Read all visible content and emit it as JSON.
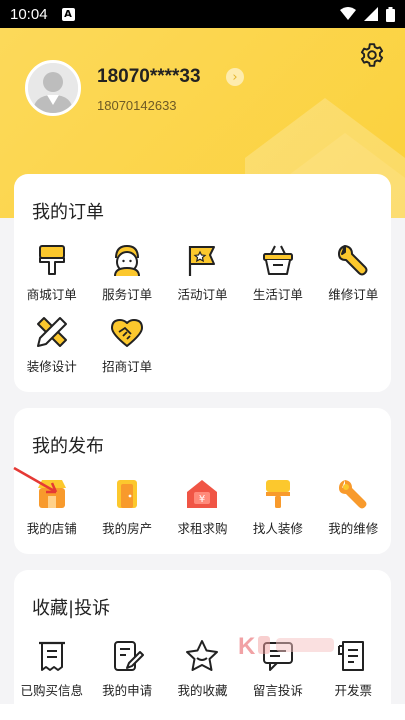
{
  "status_bar": {
    "time": "10:04",
    "app_badge": "A"
  },
  "profile": {
    "name": "18070****33",
    "sub": "18070142633"
  },
  "orders": {
    "title": "我的订单",
    "items": [
      {
        "label": "商城订单",
        "icon": "brush-icon"
      },
      {
        "label": "服务订单",
        "icon": "worker-icon"
      },
      {
        "label": "活动订单",
        "icon": "flag-icon"
      },
      {
        "label": "生活订单",
        "icon": "basket-icon"
      },
      {
        "label": "维修订单",
        "icon": "wrench-icon"
      },
      {
        "label": "装修设计",
        "icon": "ruler-pencil-icon"
      },
      {
        "label": "招商订单",
        "icon": "handshake-icon"
      }
    ]
  },
  "publish": {
    "title": "我的发布",
    "items": [
      {
        "label": "我的店铺",
        "icon": "shop-icon"
      },
      {
        "label": "我的房产",
        "icon": "door-icon"
      },
      {
        "label": "求租求购",
        "icon": "house-yen-icon"
      },
      {
        "label": "找人装修",
        "icon": "paint-roller-icon"
      },
      {
        "label": "我的维修",
        "icon": "wrench-icon"
      }
    ]
  },
  "favorites": {
    "title": "收藏|投诉",
    "items": [
      {
        "label": "已购买信息",
        "icon": "receipt-icon"
      },
      {
        "label": "我的申请",
        "icon": "edit-doc-icon"
      },
      {
        "label": "我的收藏",
        "icon": "star-icon"
      },
      {
        "label": "留言投诉",
        "icon": "chat-icon"
      },
      {
        "label": "开发票",
        "icon": "invoice-icon"
      }
    ]
  },
  "colors": {
    "accent": "#fbd13c",
    "icon_yellow": "#fcc82d",
    "icon_orange": "#f89a2c",
    "icon_red": "#f05545"
  }
}
